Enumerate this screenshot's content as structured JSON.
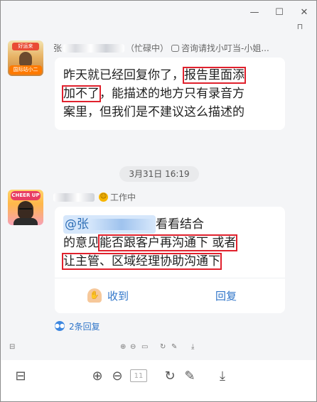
{
  "window": {
    "controls": {
      "minimize": "—",
      "maximize": "☐",
      "close": "✕"
    },
    "pin_icon": "⊓"
  },
  "messages": [
    {
      "sender_prefix": "张",
      "sender_status": "（忙碌中）",
      "sender_note": "咨询请找小叮当-小姐...",
      "avatar_badge": "国际站小二",
      "avatar_sign": "好运来",
      "lines": [
        "昨天就已经回复你了，",
        "报告里面添",
        "加不了",
        "，能描述的地方只有录音方",
        "案里，但我们是不建议这么描述的"
      ]
    },
    {
      "time": "3月31日 16:19",
      "sender_status": "工作中",
      "avatar_sign": "CHEER UP",
      "mention": "@张",
      "text_a": "看看结合",
      "text_b": "的意见",
      "text_hl1": "能否跟客户再沟通下 或者",
      "text_hl2": "让主管、区域经理协助沟通下",
      "actions": {
        "receive": "收到",
        "reply": "回复"
      },
      "thread": "2条回复"
    }
  ],
  "icons": {
    "chat": "chat-bubble-icon",
    "status": "smile-icon",
    "ok": "ok-hand-icon",
    "thread": "reply-thread-icon"
  },
  "mini_toolbar": {
    "left": "⊟",
    "icons": [
      "⊕",
      "⊖",
      "▭",
      "↻",
      "✎",
      "⤓"
    ]
  },
  "toolbar": {
    "left": "⊟",
    "icons": [
      "⊕",
      "⊖",
      "11",
      "↻",
      "✎",
      "⤓"
    ]
  },
  "colors": {
    "accent_blue": "#2f75c9",
    "highlight_red": "#e0212d",
    "bubble_bg": "#ffffff",
    "page_bg": "#f4f5f7"
  }
}
